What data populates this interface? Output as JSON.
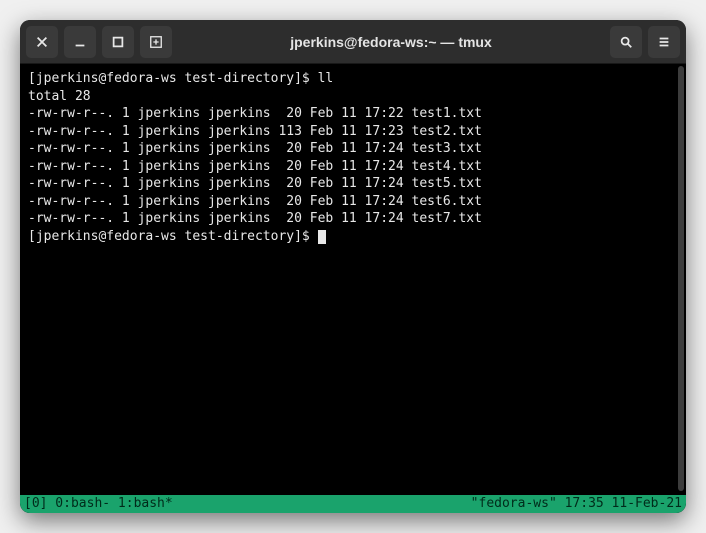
{
  "window": {
    "title": "jperkins@fedora-ws:~ — tmux"
  },
  "terminal": {
    "prompt1": "[jperkins@fedora-ws test-directory]$ ",
    "command1": "ll",
    "totalLine": "total 28",
    "files": [
      "-rw-rw-r--. 1 jperkins jperkins  20 Feb 11 17:22 test1.txt",
      "-rw-rw-r--. 1 jperkins jperkins 113 Feb 11 17:23 test2.txt",
      "-rw-rw-r--. 1 jperkins jperkins  20 Feb 11 17:24 test3.txt",
      "-rw-rw-r--. 1 jperkins jperkins  20 Feb 11 17:24 test4.txt",
      "-rw-rw-r--. 1 jperkins jperkins  20 Feb 11 17:24 test5.txt",
      "-rw-rw-r--. 1 jperkins jperkins  20 Feb 11 17:24 test6.txt",
      "-rw-rw-r--. 1 jperkins jperkins  20 Feb 11 17:24 test7.txt"
    ],
    "prompt2": "[jperkins@fedora-ws test-directory]$ "
  },
  "tmux": {
    "left": "[0] 0:bash- 1:bash*",
    "right": "\"fedora-ws\" 17:35 11-Feb-21"
  }
}
